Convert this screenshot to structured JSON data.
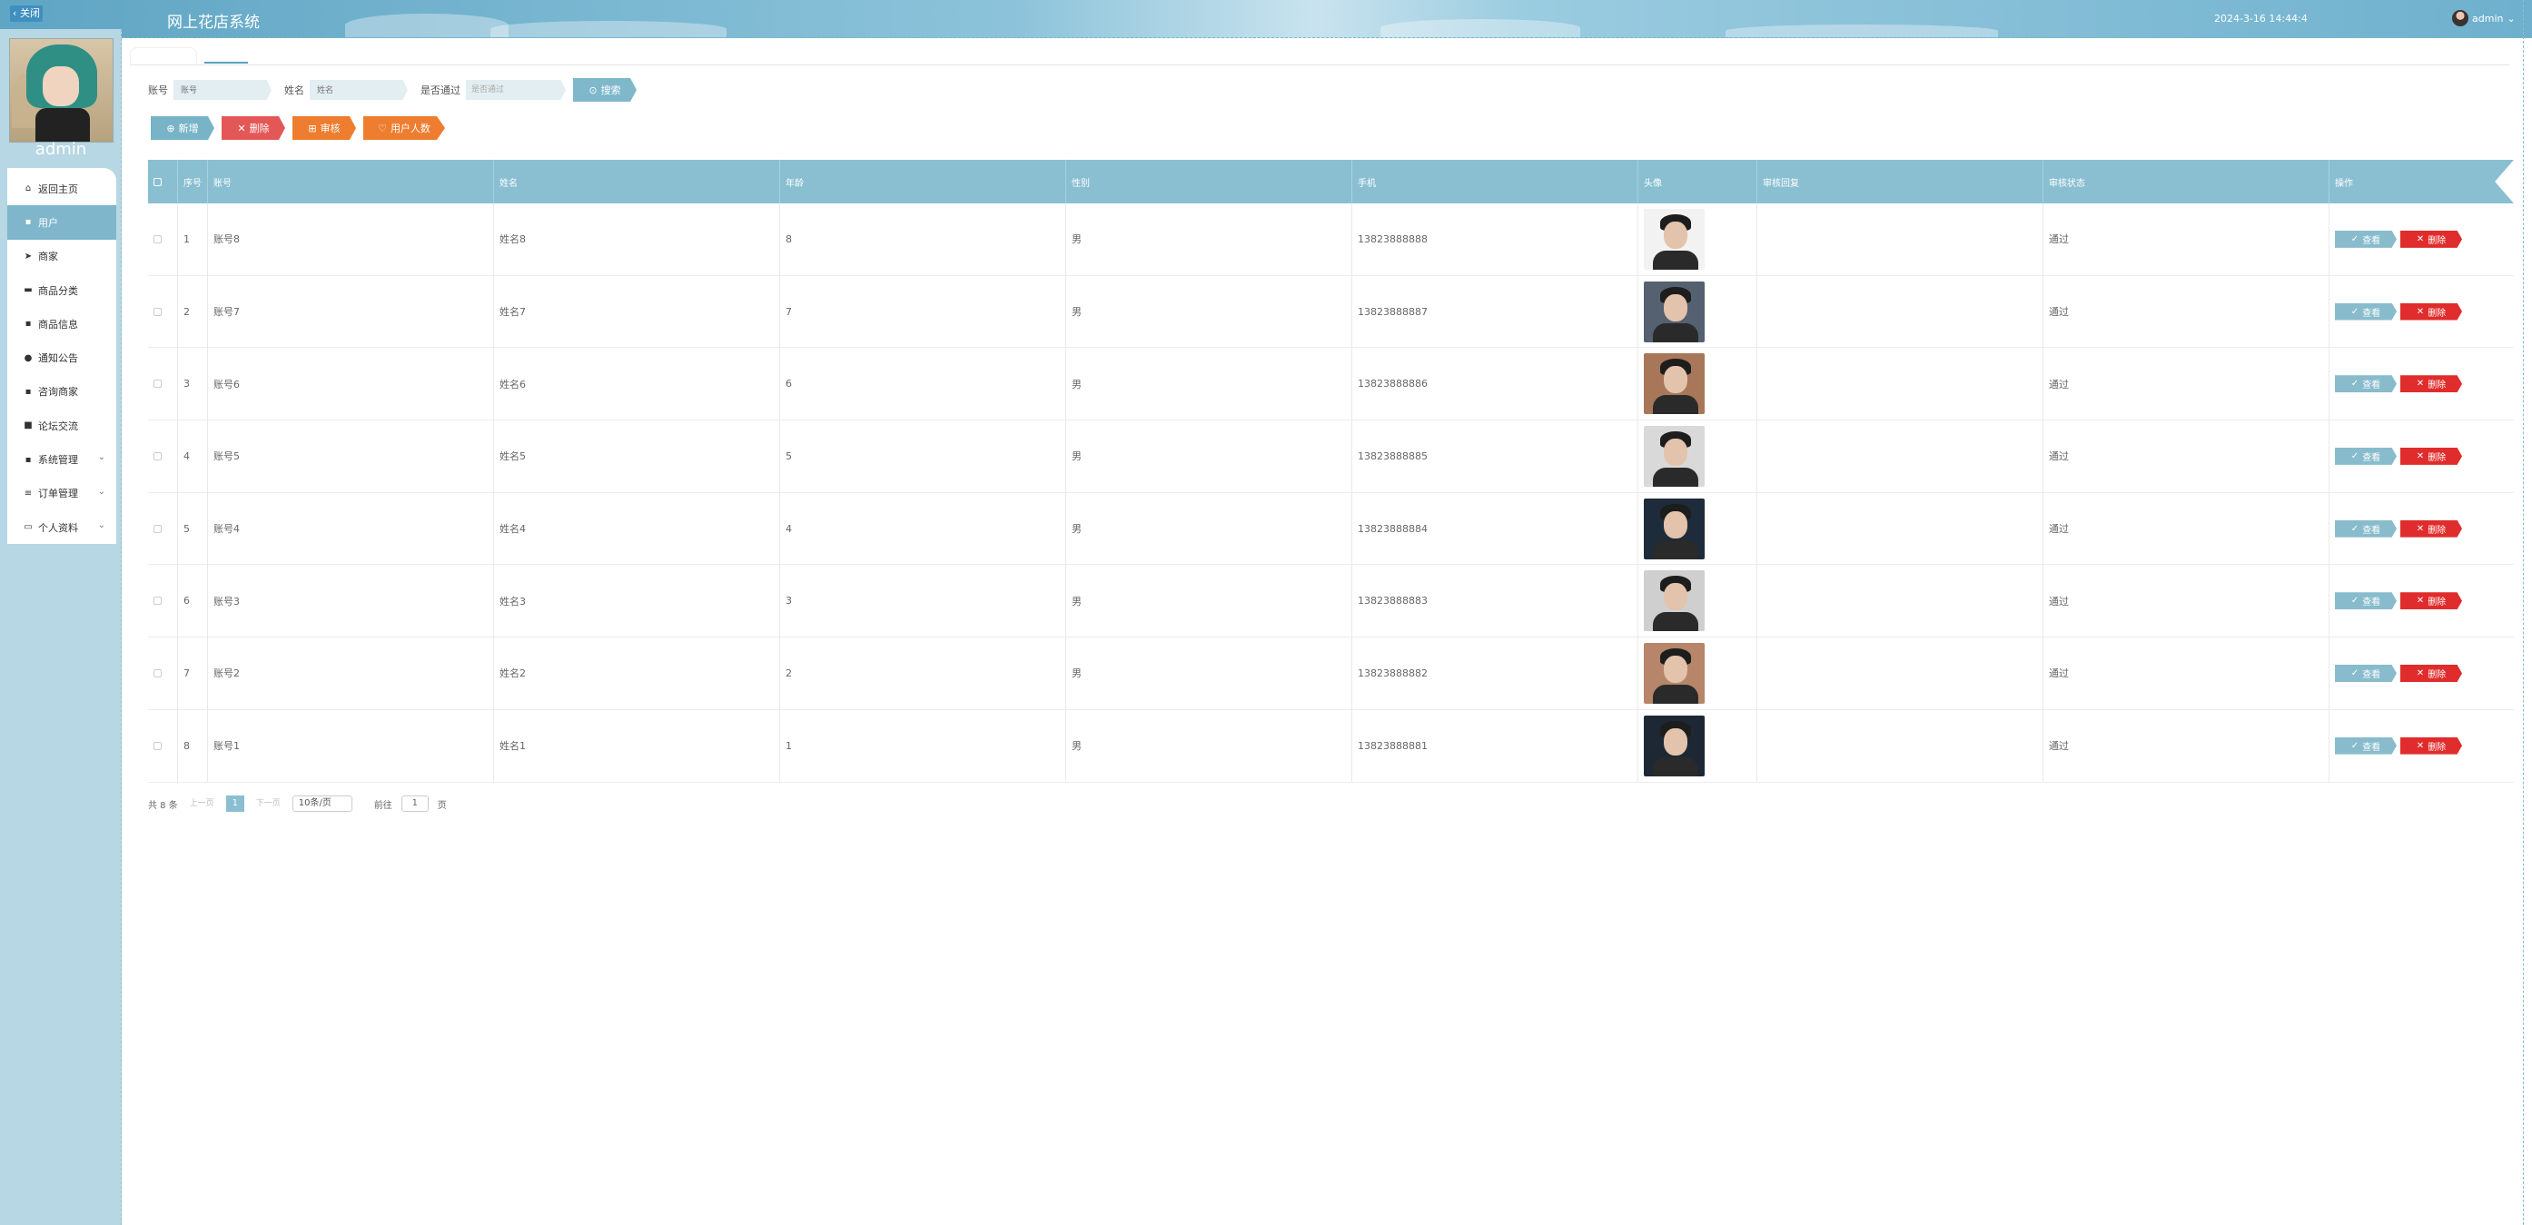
{
  "header": {
    "close_label": "关闭",
    "app_title": "网上花店系统",
    "datetime": "2024-3-16 14:44:4",
    "user_label": "admin",
    "user_chevron": "chevron-down-icon"
  },
  "sidebar": {
    "username": "admin",
    "items": [
      {
        "label": "返回主页",
        "icon": "home-icon",
        "active": false,
        "has_children": false
      },
      {
        "label": "用户",
        "icon": "grid-icon",
        "active": true,
        "has_children": false
      },
      {
        "label": "商家",
        "icon": "send-icon",
        "active": false,
        "has_children": false
      },
      {
        "label": "商品分类",
        "icon": "car-icon",
        "active": false,
        "has_children": false
      },
      {
        "label": "商品信息",
        "icon": "grid-icon",
        "active": false,
        "has_children": false
      },
      {
        "label": "通知公告",
        "icon": "user-icon",
        "active": false,
        "has_children": false
      },
      {
        "label": "咨询商家",
        "icon": "grid-icon",
        "active": false,
        "has_children": false
      },
      {
        "label": "论坛交流",
        "icon": "lock-icon",
        "active": false,
        "has_children": false
      },
      {
        "label": "系统管理",
        "icon": "grid-icon",
        "active": false,
        "has_children": true
      },
      {
        "label": "订单管理",
        "icon": "list-icon",
        "active": false,
        "has_children": true
      },
      {
        "label": "个人资料",
        "icon": "calendar-icon",
        "active": false,
        "has_children": true
      }
    ]
  },
  "search": {
    "account_label": "账号",
    "account_placeholder": "账号",
    "name_label": "姓名",
    "name_placeholder": "姓名",
    "passed_label": "是否通过",
    "passed_placeholder": "是否通过",
    "search_button": "搜索"
  },
  "actions": {
    "add": "新增",
    "delete": "删除",
    "audit": "审核",
    "user_count": "用户人数"
  },
  "table": {
    "columns": [
      "",
      "序号",
      "账号",
      "姓名",
      "年龄",
      "性别",
      "手机",
      "头像",
      "审核回复",
      "审核状态",
      "操作"
    ],
    "rows": [
      {
        "index": "1",
        "account": "账号8",
        "name": "姓名8",
        "age": "8",
        "gender": "男",
        "phone": "13823888888",
        "reply": "",
        "status": "通过"
      },
      {
        "index": "2",
        "account": "账号7",
        "name": "姓名7",
        "age": "7",
        "gender": "男",
        "phone": "13823888887",
        "reply": "",
        "status": "通过"
      },
      {
        "index": "3",
        "account": "账号6",
        "name": "姓名6",
        "age": "6",
        "gender": "男",
        "phone": "13823888886",
        "reply": "",
        "status": "通过"
      },
      {
        "index": "4",
        "account": "账号5",
        "name": "姓名5",
        "age": "5",
        "gender": "男",
        "phone": "13823888885",
        "reply": "",
        "status": "通过"
      },
      {
        "index": "5",
        "account": "账号4",
        "name": "姓名4",
        "age": "4",
        "gender": "男",
        "phone": "13823888884",
        "reply": "",
        "status": "通过"
      },
      {
        "index": "6",
        "account": "账号3",
        "name": "姓名3",
        "age": "3",
        "gender": "男",
        "phone": "13823888883",
        "reply": "",
        "status": "通过"
      },
      {
        "index": "7",
        "account": "账号2",
        "name": "姓名2",
        "age": "2",
        "gender": "男",
        "phone": "13823888882",
        "reply": "",
        "status": "通过"
      },
      {
        "index": "8",
        "account": "账号1",
        "name": "姓名1",
        "age": "1",
        "gender": "男",
        "phone": "13823888881",
        "reply": "",
        "status": "通过"
      }
    ],
    "view_label": "查看",
    "delete_label": "删除"
  },
  "pagination": {
    "total": "共 8 条",
    "prev": "上一页",
    "current_page": "1",
    "next": "下一页",
    "page_size": "10条/页",
    "goto_label": "前往",
    "goto_value": "1",
    "page_suffix": "页"
  },
  "colors": {
    "primary": "#8abfd2",
    "sidebar_bg": "#b6d7e3",
    "danger": "#e02c2c",
    "warning": "#ee7d30"
  }
}
